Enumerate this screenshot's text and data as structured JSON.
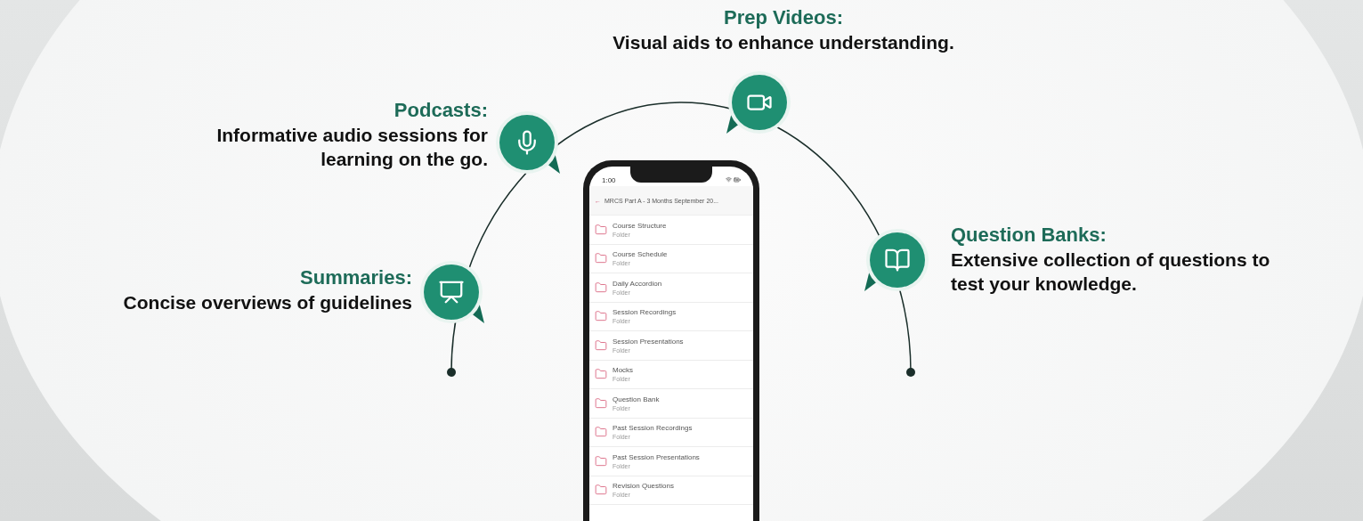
{
  "features": [
    {
      "kind": "video",
      "title": "Prep Videos:",
      "description": "Visual aids to enhance understanding."
    },
    {
      "kind": "mic",
      "title": "Podcasts:",
      "description": "Informative audio sessions for learning on the go."
    },
    {
      "kind": "book",
      "title": "Question Banks:",
      "description": "Extensive collection of questions to test your knowledge."
    },
    {
      "kind": "presenter",
      "title": "Summaries:",
      "description": "Concise overviews of guidelines"
    }
  ],
  "phone": {
    "time": "1:00",
    "back": "←",
    "title": "MRCS Part A - 3 Months September 20...",
    "items": [
      {
        "name": "Course Structure",
        "type": "Folder"
      },
      {
        "name": "Course Schedule",
        "type": "Folder"
      },
      {
        "name": "Daily Accordion",
        "type": "Folder"
      },
      {
        "name": "Session Recordings",
        "type": "Folder"
      },
      {
        "name": "Session Presentations",
        "type": "Folder"
      },
      {
        "name": "Mocks",
        "type": "Folder"
      },
      {
        "name": "Question Bank",
        "type": "Folder"
      },
      {
        "name": "Past Session Recordings",
        "type": "Folder"
      },
      {
        "name": "Past Session Presentations",
        "type": "Folder"
      },
      {
        "name": "Revision Questions",
        "type": "Folder"
      }
    ]
  }
}
